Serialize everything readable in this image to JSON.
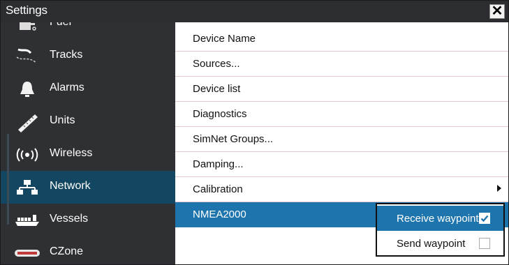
{
  "window": {
    "title": "Settings",
    "close_label": "✕"
  },
  "sidebar": {
    "items": [
      {
        "label": "Fuel",
        "icon": "fuel-icon"
      },
      {
        "label": "Tracks",
        "icon": "tracks-icon"
      },
      {
        "label": "Alarms",
        "icon": "bell-icon"
      },
      {
        "label": "Units",
        "icon": "ruler-icon"
      },
      {
        "label": "Wireless",
        "icon": "wireless-icon"
      },
      {
        "label": "Network",
        "icon": "network-icon",
        "selected": true
      },
      {
        "label": "Vessels",
        "icon": "vessels-icon"
      },
      {
        "label": "CZone",
        "icon": "czone-icon"
      }
    ]
  },
  "content": {
    "items": [
      {
        "label": "Device Name"
      },
      {
        "label": "Sources..."
      },
      {
        "label": "Device list"
      },
      {
        "label": "Diagnostics"
      },
      {
        "label": "SimNet Groups..."
      },
      {
        "label": "Damping..."
      },
      {
        "label": "Calibration",
        "has_submenu": true
      },
      {
        "label": "NMEA2000",
        "selected": true
      }
    ]
  },
  "submenu": {
    "items": [
      {
        "label": "Receive waypoint",
        "checked": true
      },
      {
        "label": "Send waypoint",
        "checked": false
      }
    ]
  },
  "colors": {
    "titlebar": "#2b2d30",
    "sidebar": "#2f3033",
    "sidebar_selected": "#134660",
    "accent": "#1e75ad"
  }
}
